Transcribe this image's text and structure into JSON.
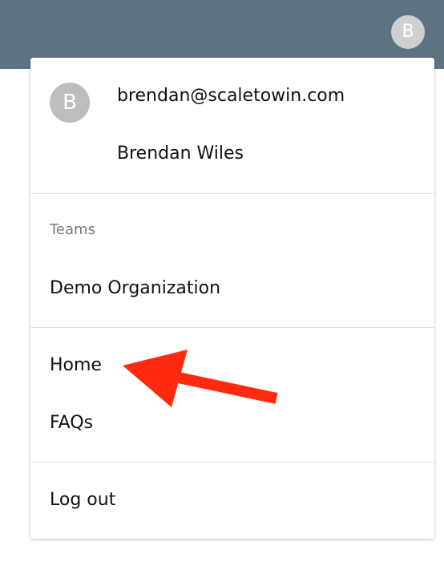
{
  "header": {
    "avatar_initial": "B"
  },
  "menu": {
    "profile": {
      "avatar_initial": "B",
      "email": "brendan@scaletowin.com",
      "name": "Brendan Wiles"
    },
    "teams": {
      "label": "Teams",
      "items": [
        {
          "label": "Demo Organization"
        }
      ]
    },
    "links": [
      {
        "label": "Home"
      },
      {
        "label": "FAQs"
      }
    ],
    "logout_label": "Log out"
  },
  "colors": {
    "header_bg": "#5d7482",
    "avatar_bg": "#bdbdbd",
    "annotation_arrow": "#ff2a10"
  },
  "annotation": {
    "icon": "red-arrow-icon",
    "points_to": "Home"
  }
}
